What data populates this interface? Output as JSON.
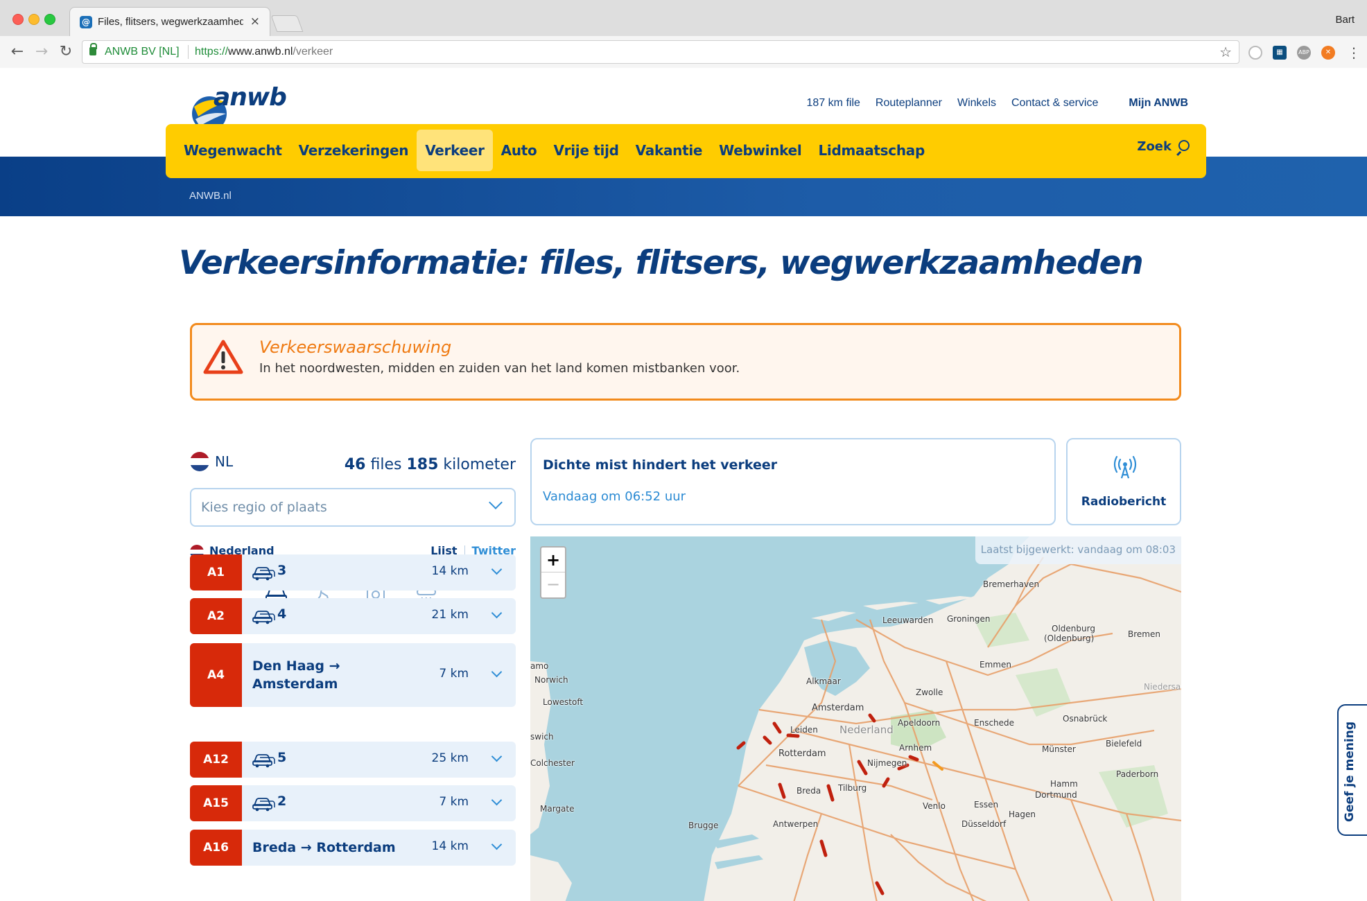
{
  "browser": {
    "tab_title": "Files, flitsers, wegwerkzaamheden",
    "profile": "Bart",
    "secure_label": "ANWB BV [NL]",
    "url_scheme": "https://",
    "url_host": "www.anwb.nl",
    "url_path": "/verkeer",
    "tab_close": "×",
    "ext_abp": "ABP"
  },
  "header": {
    "logo_text": "anwb",
    "top_links": [
      "187 km file",
      "Routeplanner",
      "Winkels",
      "Contact & service"
    ],
    "account_link": "Mijn ANWB",
    "nav": [
      "Wegenwacht",
      "Verzekeringen",
      "Verkeer",
      "Auto",
      "Vrije tijd",
      "Vakantie",
      "Webwinkel",
      "Lidmaatschap"
    ],
    "nav_active": "Verkeer",
    "search_label": "Zoek",
    "breadcrumb": "ANWB.nl"
  },
  "page": {
    "title": "Verkeersinformatie: files, flitsers, wegwerkzaamheden"
  },
  "warning": {
    "title": "Verkeerswaarschuwing",
    "text": "In het noordwesten, midden en zuiden van het land komen mistbanken voor."
  },
  "summary": {
    "country_code": "NL",
    "files_count": "46",
    "files_label": "files",
    "km_count": "185",
    "km_label": "kilometer"
  },
  "region_select": {
    "placeholder": "Kies regio of plaats"
  },
  "list": {
    "country": "Nederland",
    "view_list": "Lijst",
    "view_twitter": "Twitter",
    "filters": [
      "car-jam-filter-icon",
      "roadworks-filter-icon",
      "speed-camera-filter-icon",
      "weather-filter-icon"
    ],
    "rows": [
      {
        "road": "A1",
        "count": "3",
        "route_from": "",
        "route_to": "",
        "km": "14 km"
      },
      {
        "road": "A2",
        "count": "4",
        "route_from": "",
        "route_to": "",
        "km": "21 km"
      },
      {
        "road": "A4",
        "count": "",
        "route_from": "Den Haag",
        "route_to": "Amsterdam",
        "km": "7 km"
      },
      {
        "road": "A12",
        "count": "5",
        "route_from": "",
        "route_to": "",
        "km": "25 km"
      },
      {
        "road": "A15",
        "count": "2",
        "route_from": "",
        "route_to": "",
        "km": "7 km"
      },
      {
        "road": "A16",
        "count": "",
        "route_from": "Breda",
        "route_to": "Rotterdam",
        "km": "14 km"
      }
    ]
  },
  "news": {
    "title": "Dichte mist hindert het verkeer",
    "time": "Vandaag om 06:52 uur"
  },
  "radio": {
    "label": "Radiobericht"
  },
  "map": {
    "updated": "Laatst bijgewerkt: vandaag om 08:03",
    "zoom_in": "+",
    "zoom_out": "−",
    "cities": [
      "Bremerhaven",
      "Leeuwarden",
      "Groningen",
      "Oldenburg",
      "(Oldenburg)",
      "Bremen",
      "Emmen",
      "Niedersac",
      "Alkmaar",
      "Zwolle",
      "Norwich",
      "Lowestoft",
      "Amsterdam",
      "Apeldoorn",
      "Enschede",
      "Osnabrück",
      "Leiden",
      "Nederland",
      "Arnhem",
      "Bielefeld",
      "Münster",
      "Rotterdam",
      "Nijmegen",
      "Paderborn",
      "Colchester",
      "Breda",
      "Tilburg",
      "Hamm",
      "Dortmund",
      "Margate",
      "Venlo",
      "Essen",
      "Hagen",
      "Brugge",
      "Antwerpen",
      "Düsseldorf",
      "amo",
      "swich"
    ]
  },
  "feedback": {
    "label": "Geef je mening"
  },
  "colors": {
    "brand_blue": "#0b3d7e",
    "brand_yellow": "#ffcc00",
    "road_red": "#d7290a",
    "warning_orange": "#f28a1c",
    "link_blue": "#2f8ed6"
  }
}
